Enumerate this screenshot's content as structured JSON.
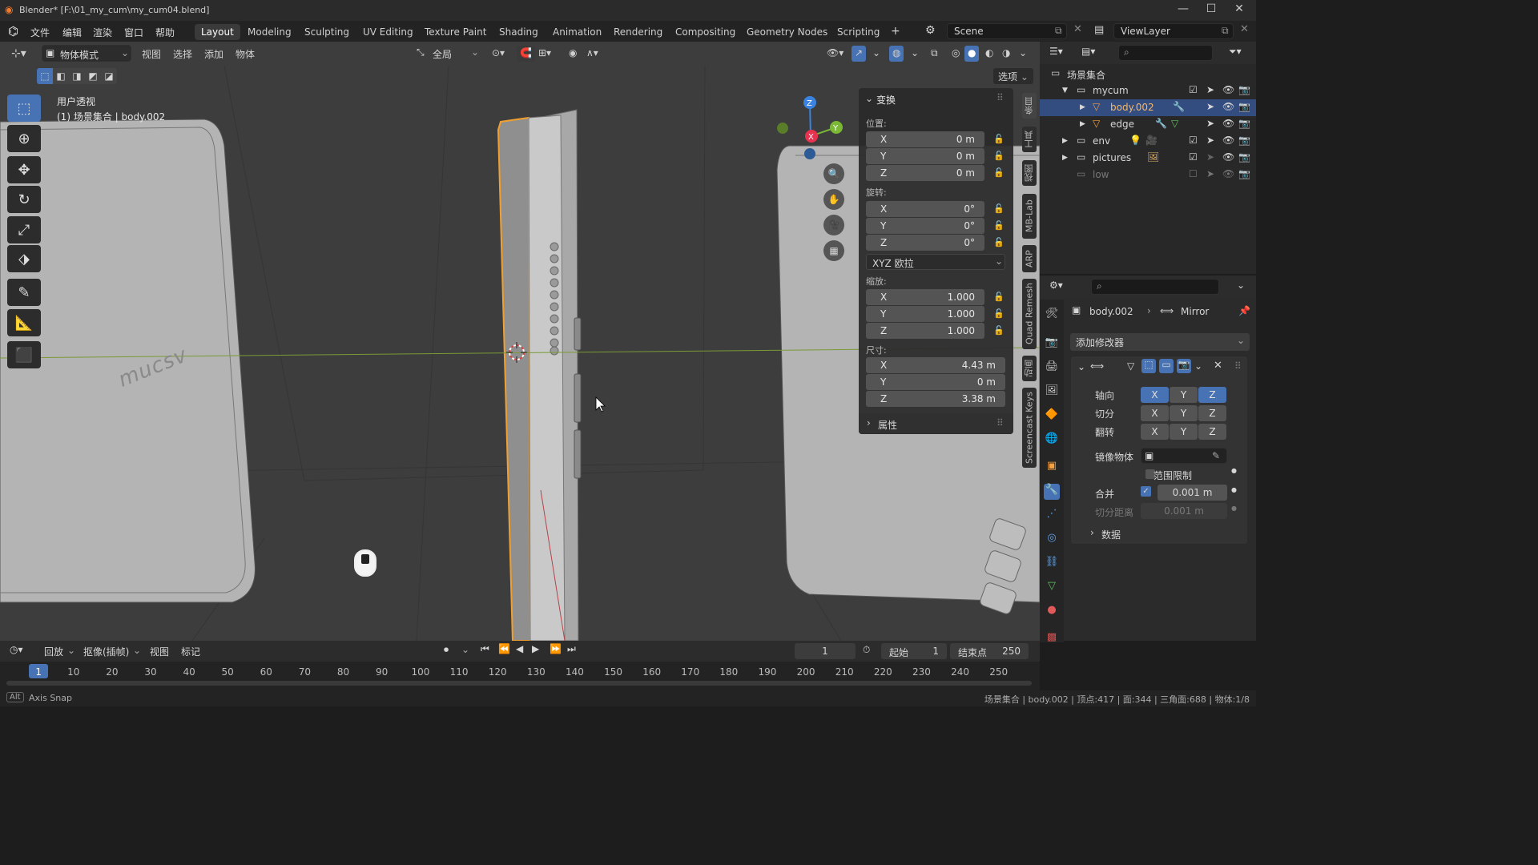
{
  "window": {
    "title": "Blender* [F:\\01_my_cum\\my_cum04.blend]",
    "controls": [
      "—",
      "☐",
      "✕"
    ]
  },
  "menubar": {
    "menus": [
      "文件",
      "编辑",
      "渲染",
      "窗口",
      "帮助"
    ],
    "workspaces": [
      "Layout",
      "Modeling",
      "Sculpting",
      "UV Editing",
      "Texture Paint",
      "Shading",
      "Animation",
      "Rendering",
      "Compositing",
      "Geometry Nodes",
      "Scripting"
    ],
    "active_workspace": "Layout",
    "add_tab": "+",
    "scene": "Scene",
    "view_layer": "ViewLayer"
  },
  "viewport": {
    "mode": "物体模式",
    "menus": [
      "视图",
      "选择",
      "添加",
      "物体"
    ],
    "transform_orientation": "全局",
    "options": "选项",
    "overlay_title": "用户透视",
    "overlay_subtitle": "(1) 场景集合 | body.002",
    "decal_text": "mucsv",
    "gizmo_axes": [
      "X",
      "Y",
      "Z"
    ]
  },
  "npanel": {
    "section": "变换",
    "location_label": "位置:",
    "location": [
      {
        "axis": "X",
        "value": "0 m"
      },
      {
        "axis": "Y",
        "value": "0 m"
      },
      {
        "axis": "Z",
        "value": "0 m"
      }
    ],
    "rotation_label": "旋转:",
    "rotation": [
      {
        "axis": "X",
        "value": "0°"
      },
      {
        "axis": "Y",
        "value": "0°"
      },
      {
        "axis": "Z",
        "value": "0°"
      }
    ],
    "rotation_mode": "XYZ 欧拉",
    "scale_label": "缩放:",
    "scale": [
      {
        "axis": "X",
        "value": "1.000"
      },
      {
        "axis": "Y",
        "value": "1.000"
      },
      {
        "axis": "Z",
        "value": "1.000"
      }
    ],
    "dimensions_label": "尺寸:",
    "dimensions": [
      {
        "axis": "X",
        "value": "4.43 m"
      },
      {
        "axis": "Y",
        "value": "0 m"
      },
      {
        "axis": "Z",
        "value": "3.38 m"
      }
    ],
    "properties_section": "属性"
  },
  "side_tabs": [
    "条目",
    "工具",
    "视图",
    "MB-Lab",
    "ARP",
    "Quad Remesh",
    "动画",
    "Screencast Keys"
  ],
  "outliner": {
    "root": "场景集合",
    "items": [
      {
        "name": "mycum",
        "level": 1,
        "type": "collection"
      },
      {
        "name": "body.002",
        "level": 2,
        "type": "mesh",
        "selected": true
      },
      {
        "name": "edge",
        "level": 2,
        "type": "mesh"
      },
      {
        "name": "env",
        "level": 1,
        "type": "collection"
      },
      {
        "name": "pictures",
        "level": 1,
        "type": "collection"
      },
      {
        "name": "low",
        "level": 1,
        "type": "collection",
        "disabled": true
      }
    ]
  },
  "properties": {
    "object": "body.002",
    "modifier": "Mirror",
    "add_modifier": "添加修改器",
    "axis_label": "轴向",
    "bisect_label": "切分",
    "flip_label": "翻转",
    "axes": [
      "X",
      "Y",
      "Z"
    ],
    "axis_on": [
      true,
      false,
      true
    ],
    "mirror_object_label": "镜像物体",
    "clip_label": "范围限制",
    "merge_label": "合并",
    "merge_value": "0.001 m",
    "bisect_distance_label": "切分距离",
    "bisect_distance_value": "0.001 m",
    "data_label": "数据"
  },
  "timeline": {
    "menus": [
      "回放",
      "抠像(插帧)",
      "视图",
      "标记"
    ],
    "current_frame": "1",
    "start_label": "起始",
    "start": "1",
    "end_label": "结束点",
    "end": "250",
    "ticks": [
      "1",
      "10",
      "20",
      "30",
      "40",
      "50",
      "60",
      "70",
      "80",
      "90",
      "100",
      "110",
      "120",
      "130",
      "140",
      "150",
      "160",
      "170",
      "180",
      "190",
      "200",
      "210",
      "220",
      "230",
      "240",
      "250"
    ]
  },
  "status": {
    "hint_key": "Alt",
    "hint": "Axis Snap",
    "stats": "场景集合 | body.002 | 顶点:417 | 面:344 | 三角面:688 | 物体:1/8"
  },
  "colors": {
    "accent": "#4772b3",
    "selection": "#f0a030",
    "x_axis": "#e8324f",
    "y_axis": "#7ab836",
    "z_axis": "#3b83e0"
  }
}
